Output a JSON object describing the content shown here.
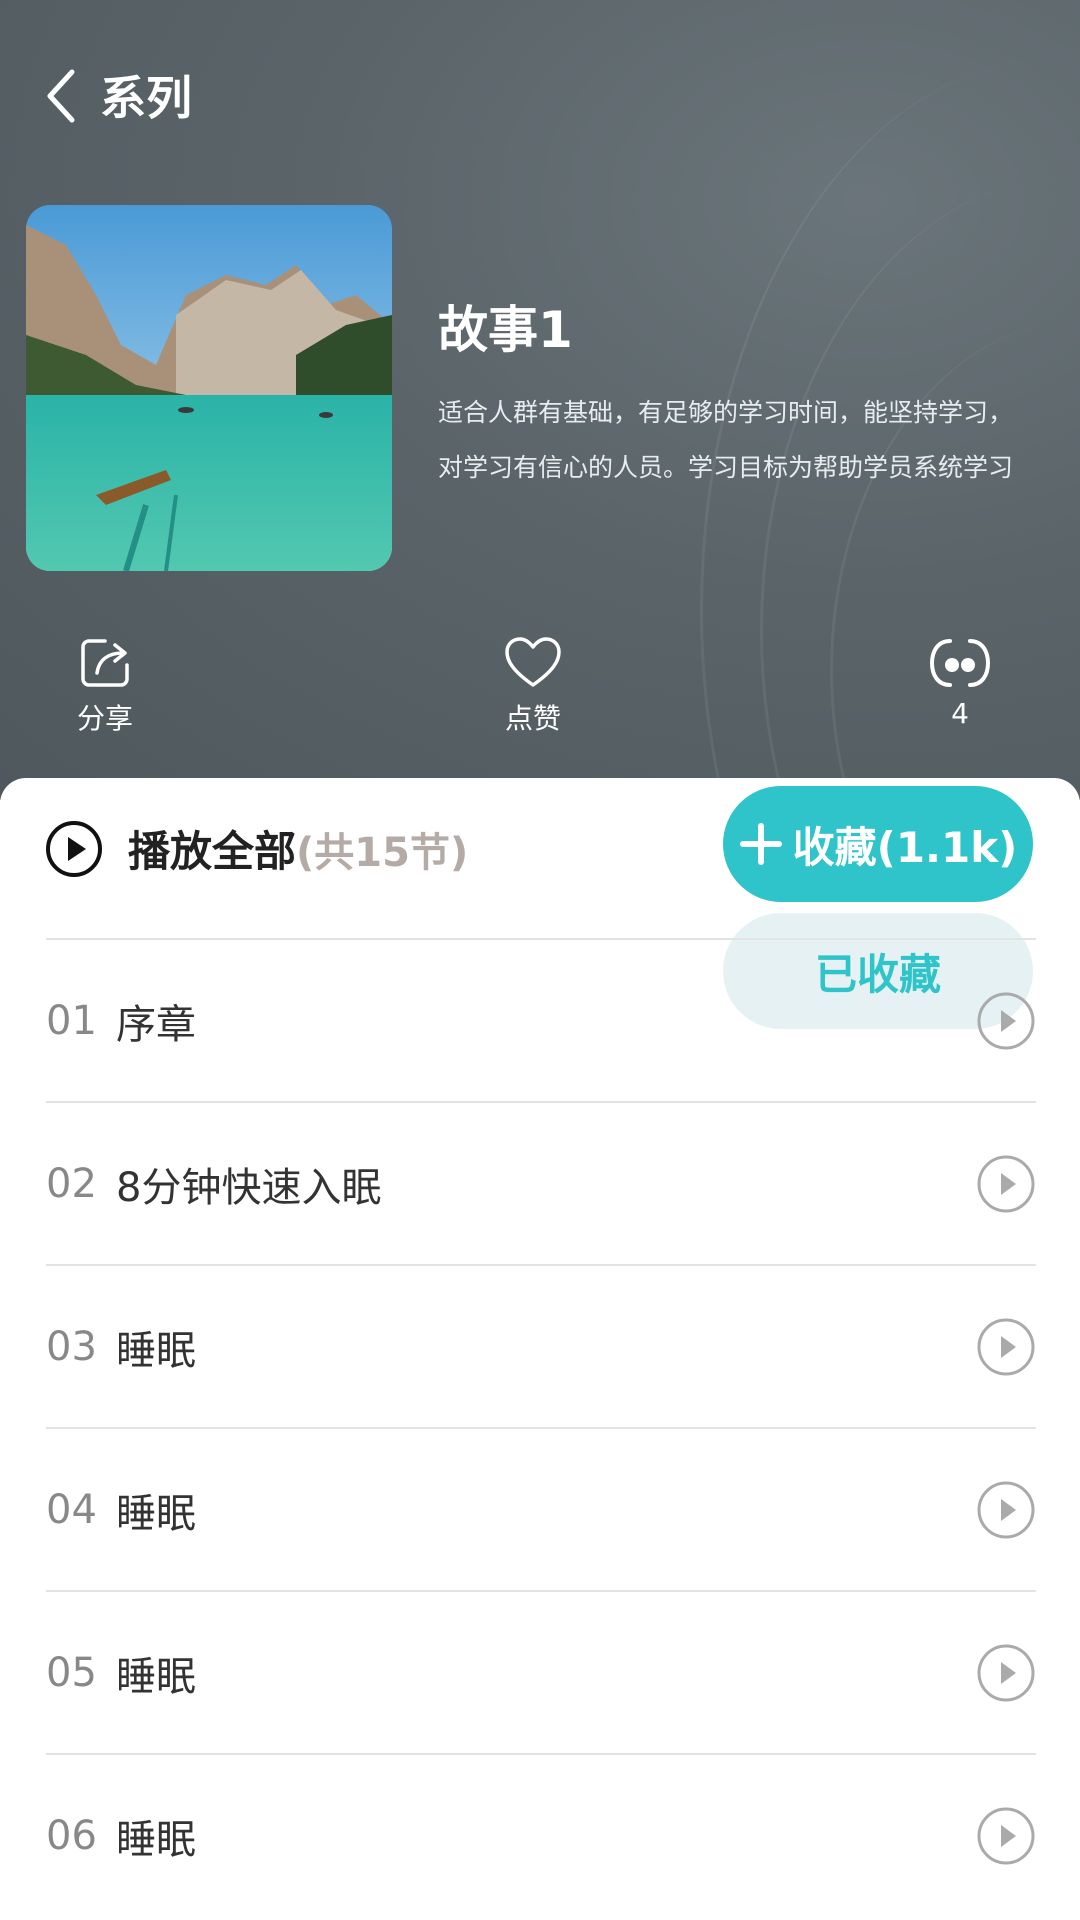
{
  "nav": {
    "back_icon": "chevron-left-icon",
    "title": "系列"
  },
  "album": {
    "title": "故事1",
    "description": "适合人群有基础，有足够的学习时间，能坚持学习，对学习有信心的人员。学习目标为帮助学员系统学习"
  },
  "actions": [
    {
      "icon": "share-icon",
      "label": "分享"
    },
    {
      "icon": "heart-icon",
      "label": "点赞"
    },
    {
      "icon": "comment-icon",
      "label": "4"
    }
  ],
  "playall": {
    "icon": "play-circle-icon",
    "label": "播放全部",
    "count": "(共15节)"
  },
  "favorite": {
    "icon": "plus-icon",
    "label": "收藏(1.1k)",
    "faved_label": "已收藏",
    "accent": "#2ec4c9"
  },
  "episodes": [
    {
      "num": "01",
      "title": "序章"
    },
    {
      "num": "02",
      "title": "8分钟快速入眠"
    },
    {
      "num": "03",
      "title": "睡眠"
    },
    {
      "num": "04",
      "title": "睡眠"
    },
    {
      "num": "05",
      "title": "睡眠"
    },
    {
      "num": "06",
      "title": "睡眠"
    }
  ]
}
